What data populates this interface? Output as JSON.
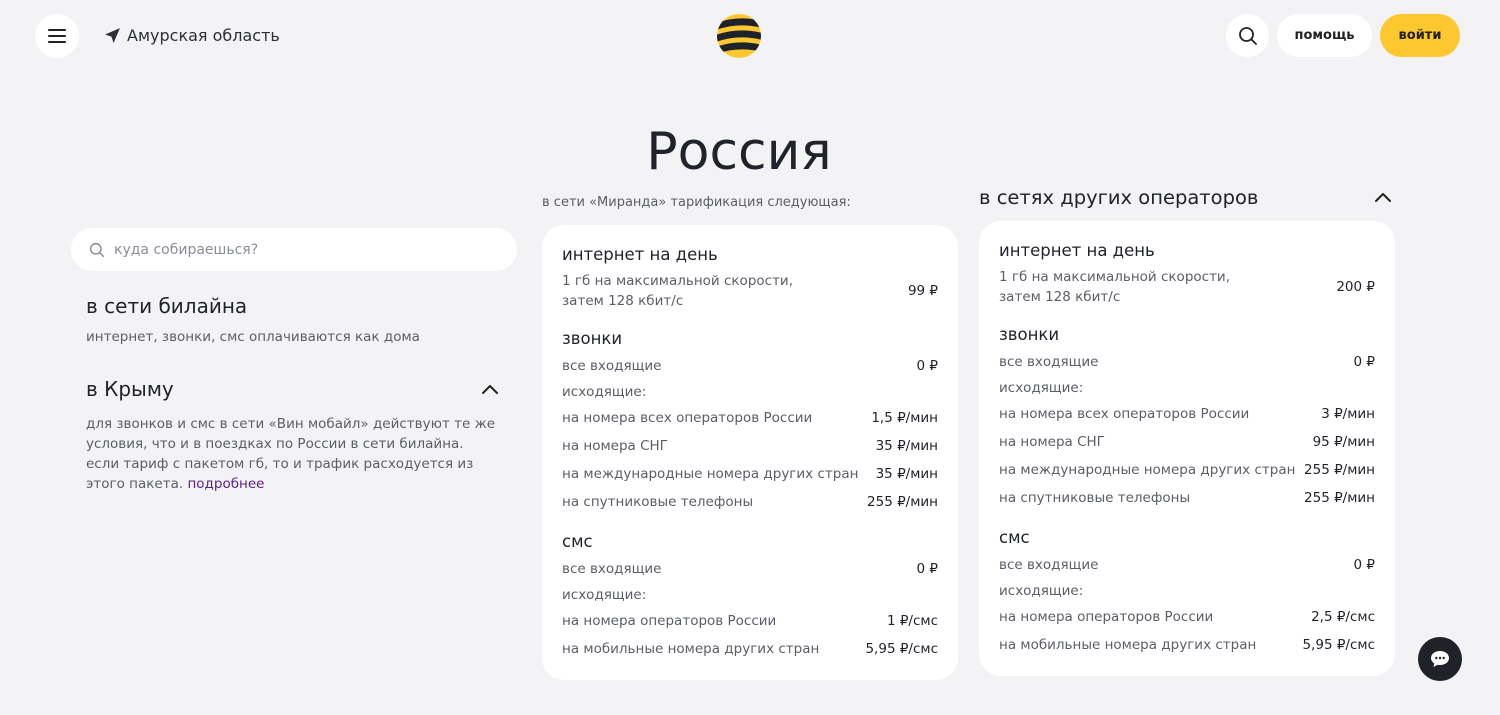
{
  "header": {
    "region": "Амурская область",
    "help_label": "помощь",
    "login_label": "войти"
  },
  "page_title": "Россия",
  "search": {
    "placeholder": "куда собираешься?"
  },
  "left": {
    "section1": {
      "title": "в сети билайна",
      "text": "интернет, звонки, смс оплачиваются как дома"
    },
    "section2": {
      "title": "в Крыму",
      "text": "для звонков и смс в сети «Вин мобайл» действуют те же условия, что и в поездках по России в сети билайна. если тариф с пакетом гб, то и трафик расходуется из этого пакета.",
      "link": "подробнее"
    }
  },
  "middle": {
    "note": "в сети «Миранда» тарификация следующая:",
    "internet_title": "интернет на день",
    "internet_desc": "1 гб на максимальной скорости, затем 128 кбит/с",
    "internet_price": "99 ₽",
    "calls_title": "звонки",
    "calls_incoming": "все входящие",
    "calls_incoming_price": "0 ₽",
    "calls_outgoing": "исходящие:",
    "calls_rows": [
      {
        "label": "на номера всех операторов России",
        "price": "1,5 ₽/мин"
      },
      {
        "label": "на номера СНГ",
        "price": "35 ₽/мин"
      },
      {
        "label": "на международные номера других стран",
        "price": "35 ₽/мин"
      },
      {
        "label": "на спутниковые телефоны",
        "price": "255 ₽/мин"
      }
    ],
    "sms_title": "смс",
    "sms_incoming": "все входящие",
    "sms_incoming_price": "0 ₽",
    "sms_outgoing": "исходящие:",
    "sms_rows": [
      {
        "label": "на номера операторов России",
        "price": "1 ₽/смс"
      },
      {
        "label": "на мобильные номера других стран",
        "price": "5,95 ₽/смс"
      }
    ]
  },
  "right": {
    "title": "в сетях других операторов",
    "internet_title": "интернет на день",
    "internet_desc": "1 гб на максимальной скорости, затем 128 кбит/с",
    "internet_price": "200 ₽",
    "calls_title": "звонки",
    "calls_incoming": "все входящие",
    "calls_incoming_price": "0 ₽",
    "calls_outgoing": "исходящие:",
    "calls_rows": [
      {
        "label": "на номера всех операторов России",
        "price": "3 ₽/мин"
      },
      {
        "label": "на номера СНГ",
        "price": "95 ₽/мин"
      },
      {
        "label": "на международные номера других стран",
        "price": "255 ₽/мин"
      },
      {
        "label": "на спутниковые телефоны",
        "price": "255 ₽/мин"
      }
    ],
    "sms_title": "смс",
    "sms_incoming": "все входящие",
    "sms_incoming_price": "0 ₽",
    "sms_outgoing": "исходящие:",
    "sms_rows": [
      {
        "label": "на номера операторов России",
        "price": "2,5 ₽/смс"
      },
      {
        "label": "на мобильные номера других стран",
        "price": "5,95 ₽/смс"
      }
    ]
  },
  "colors": {
    "accent_yellow": "#fdc82f",
    "link_purple": "#5a1f8c",
    "background": "#f3f3f5",
    "dark": "#1f2229"
  }
}
